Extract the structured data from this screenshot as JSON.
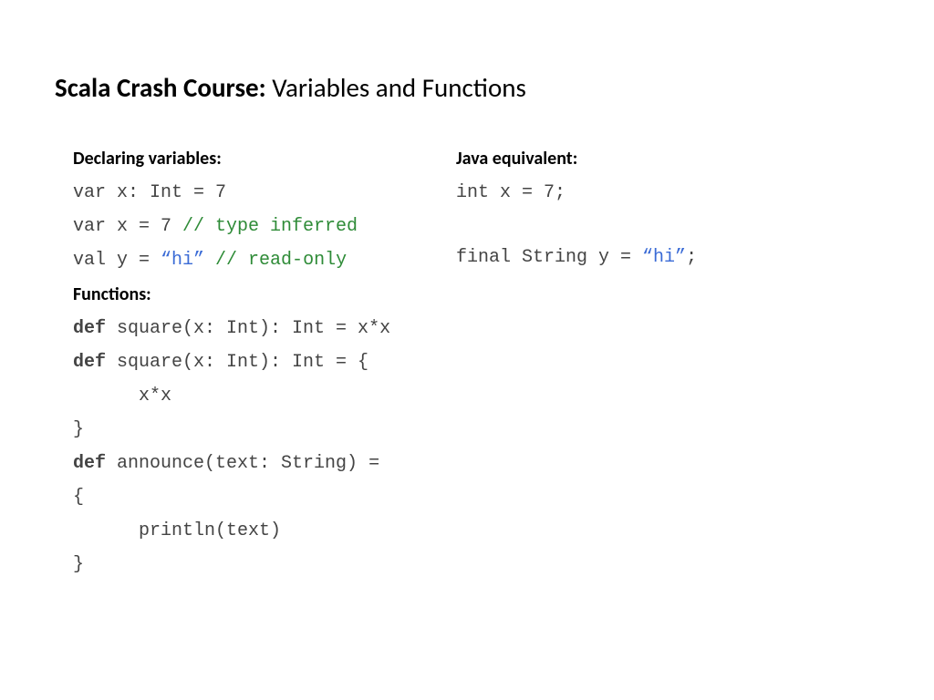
{
  "title_bold": "Scala Crash Course:",
  "title_rest": " Variables and Functions",
  "left": {
    "heading_vars": "Declaring variables:",
    "line1": "var x: Int = 7",
    "line2_code": "var x = 7 ",
    "line2_comment": "// type inferred",
    "line3_code": "val y = ",
    "line3_str": "“hi”",
    "line3_space": " ",
    "line3_comment": "// read-only",
    "heading_funcs": "Functions:",
    "line4_kw": "def",
    "line4_rest": " square(x: Int): Int = x*x",
    "line5_kw": "def",
    "line5_rest": " square(x: Int): Int = {",
    "line6": "      x*x",
    "line7": "}",
    "line8_kw": "def",
    "line8_rest": " announce(text: String) =",
    "line9": "{",
    "line10": "      println(text)",
    "line11": "}"
  },
  "right": {
    "heading_java": "Java equivalent:",
    "jline1": "int x = 7;",
    "jline2_code": "final String y = ",
    "jline2_str": "“hi”",
    "jline2_end": ";"
  }
}
